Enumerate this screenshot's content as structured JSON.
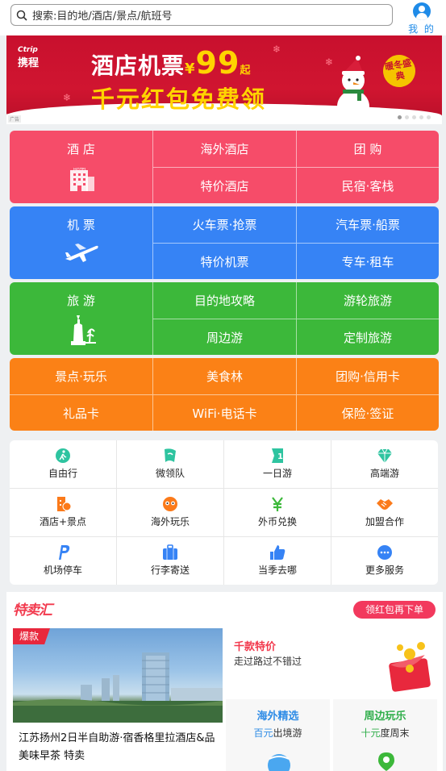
{
  "header": {
    "search_placeholder": "搜索:目的地/酒店/景点/航班号",
    "me_label": "我 的"
  },
  "banner": {
    "logo_en": "Ctrip",
    "logo_cn": "携程",
    "line1_text": "酒店机票",
    "line1_currency": "¥",
    "line1_price": "99",
    "line1_suffix": "起",
    "line2": "千元红包免费领",
    "badge": "暖冬盛典",
    "corner_tag": "广告"
  },
  "grid": {
    "hotel": {
      "main": "酒 店",
      "items": [
        "海外酒店",
        "团 购",
        "特价酒店",
        "民宿·客栈"
      ],
      "color": "#f64c69"
    },
    "flight": {
      "main": "机 票",
      "items": [
        "火车票·抢票",
        "汽车票·船票",
        "特价机票",
        "专车·租车"
      ],
      "color": "#3683f5"
    },
    "travel": {
      "main": "旅 游",
      "items": [
        "目的地攻略",
        "游轮旅游",
        "周边游",
        "定制旅游"
      ],
      "color": "#3cb83a"
    },
    "fun": {
      "items": [
        "景点·玩乐",
        "美食林",
        "团购·信用卡",
        "礼品卡",
        "WiFi·电话卡",
        "保险·签证"
      ],
      "color": "#fb8116"
    }
  },
  "services": [
    {
      "label": "自由行",
      "icon": "walker-icon"
    },
    {
      "label": "微领队",
      "icon": "flag-icon"
    },
    {
      "label": "一日游",
      "icon": "one-day-icon"
    },
    {
      "label": "高端游",
      "icon": "diamond-icon"
    },
    {
      "label": "酒店+景点",
      "icon": "hotel-scenic-icon"
    },
    {
      "label": "海外玩乐",
      "icon": "mask-icon"
    },
    {
      "label": "外币兑换",
      "icon": "yen-icon"
    },
    {
      "label": "加盟合作",
      "icon": "handshake-icon"
    },
    {
      "label": "机场停车",
      "icon": "parking-icon"
    },
    {
      "label": "行李寄送",
      "icon": "luggage-icon"
    },
    {
      "label": "当季去哪",
      "icon": "thumb-up-icon"
    },
    {
      "label": "更多服务",
      "icon": "more-icon"
    }
  ],
  "deals": {
    "logo": "特卖汇",
    "coupon_button": "领红包再下单",
    "hot": {
      "tag": "爆款",
      "title": "江苏扬州2日半自助游·宿香格里拉酒店&品美味早茶 特卖"
    },
    "side": {
      "title": "千款特价",
      "subtitle": "走过路过不错过"
    },
    "overseas": {
      "title": "海外精选",
      "sub_highlight": "百元",
      "sub_rest": "出境游"
    },
    "nearby": {
      "title": "周边玩乐",
      "sub_highlight": "十元",
      "sub_rest": "度周末"
    }
  },
  "colors": {
    "accent_blue": "#1f8be8",
    "deal_red": "#f2394d",
    "overseas_blue": "#2f8ce6",
    "nearby_green": "#2fae4a"
  }
}
